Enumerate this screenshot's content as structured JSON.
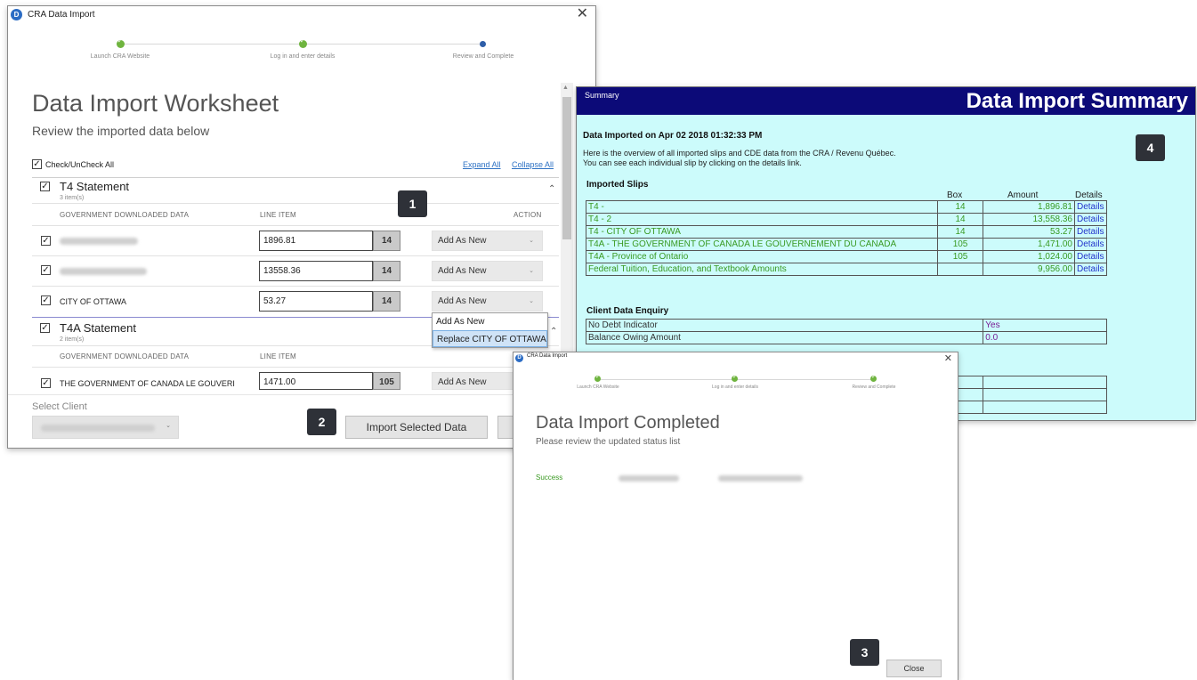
{
  "worksheet_window": {
    "title": "CRA Data Import",
    "close_glyph": "✕",
    "steps": [
      "Launch CRA Website",
      "Log in and enter details",
      "Review and Complete"
    ],
    "heading": "Data Import Worksheet",
    "subheading": "Review the imported data below",
    "check_all_label": "Check/UnCheck All",
    "expand_all": "Expand All",
    "collapse_all": "Collapse All",
    "sections": [
      {
        "title": "T4 Statement",
        "count": "3 item(s)",
        "col_gov": "GOVERNMENT DOWNLOADED DATA",
        "col_line": "LINE ITEM",
        "col_action": "ACTION",
        "rows": [
          {
            "label": "",
            "value": "1896.81",
            "box": "14",
            "action": "Add As New"
          },
          {
            "label": "",
            "value": "13558.36",
            "box": "14",
            "action": "Add As New"
          },
          {
            "label": "CITY OF OTTAWA",
            "value": "53.27",
            "box": "14",
            "action": "Add As New"
          }
        ]
      },
      {
        "title": "T4A Statement",
        "count": "2 item(s)",
        "col_gov": "GOVERNMENT DOWNLOADED DATA",
        "col_line": "LINE ITEM",
        "rows": [
          {
            "label": "THE GOVERNMENT OF CANADA LE GOUVERI",
            "value": "1471.00",
            "box": "105",
            "action": "Add As New"
          }
        ]
      }
    ],
    "dropdown_options": [
      "Add As New",
      "Replace CITY OF OTTAWA"
    ],
    "select_client_label": "Select Client",
    "import_button": "Import Selected Data"
  },
  "callouts": [
    "1",
    "2",
    "3",
    "4"
  ],
  "summary_window": {
    "tag": "Summary",
    "title": "Data Import Summary",
    "imported_on": "Data Imported on Apr 02 2018 01:32:33 PM",
    "intro_line1": "Here is the overview of all imported slips and CDE data from the CRA / Revenu Québec.",
    "intro_line2": "You can see each individual slip by clicking on the details link.",
    "slips_heading": "Imported Slips",
    "col_box": "Box",
    "col_amount": "Amount",
    "col_details": "Details",
    "slips": [
      {
        "name": "T4 - ",
        "box": "14",
        "amount": "1,896.81",
        "details": "Details"
      },
      {
        "name": "T4 - 2",
        "box": "14",
        "amount": "13,558.36",
        "details": "Details"
      },
      {
        "name": "T4 - CITY OF OTTAWA",
        "box": "14",
        "amount": "53.27",
        "details": "Details"
      },
      {
        "name": "T4A - THE GOVERNMENT OF CANADA LE GOUVERNEMENT DU CANADA",
        "box": "105",
        "amount": "1,471.00",
        "details": "Details"
      },
      {
        "name": "T4A - Province of Ontario",
        "box": "105",
        "amount": "1,024.00",
        "details": "Details"
      },
      {
        "name": "Federal Tuition, Education, and Textbook Amounts",
        "box": "",
        "amount": "9,956.00",
        "details": "Details"
      }
    ],
    "cde_heading": "Client Data Enquiry",
    "cde_rows": [
      {
        "label": "No Debt Indicator",
        "value": "Yes"
      },
      {
        "label": "Balance Owing Amount",
        "value": "0.0"
      }
    ]
  },
  "completed_window": {
    "title": "CRA Data Import",
    "close_glyph": "✕",
    "steps": [
      "Launch CRA Website",
      "Log in and enter details",
      "Review and Complete"
    ],
    "heading": "Data Import Completed",
    "subheading": "Please review the updated status list",
    "status": "Success",
    "close_button": "Close"
  },
  "colors": {
    "summary_header": "#0c0a78",
    "summary_bg": "#ccfbfb",
    "success_green": "#3a9a22",
    "step_done": "#6fb43f",
    "step_current": "#2e5ea8"
  }
}
